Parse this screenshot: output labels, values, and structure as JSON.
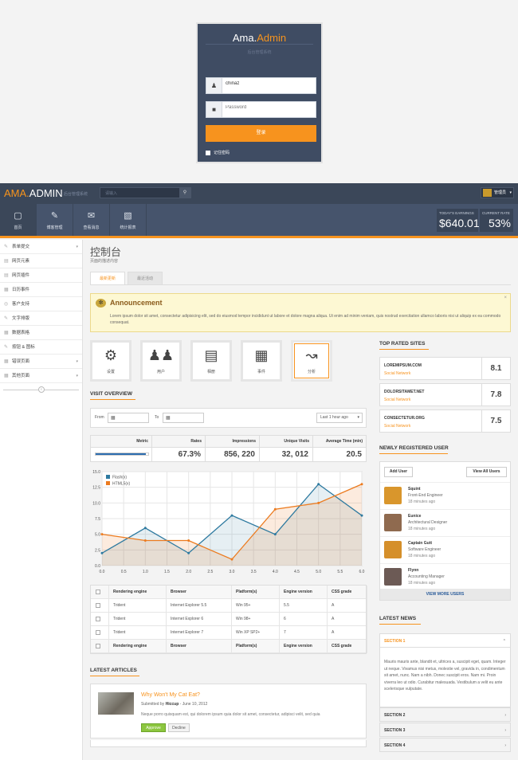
{
  "login": {
    "brand_a": "Ama.",
    "brand_b": "Admin",
    "subtitle": "后台管理系统",
    "username": "chinaz",
    "password_placeholder": "Password",
    "submit": "登录",
    "remember": "记住密码"
  },
  "topbar": {
    "logo_a": "AMA.",
    "logo_b": "ADMIN",
    "tagline": "后台管理系统",
    "search_placeholder": "请输入",
    "user": "管理员"
  },
  "nav": {
    "items": [
      {
        "label": "首页",
        "icon": "monitor-icon"
      },
      {
        "label": "博客管理",
        "icon": "pencil-icon"
      },
      {
        "label": "查看消息",
        "icon": "mail-icon"
      },
      {
        "label": "统计报表",
        "icon": "bars-icon"
      }
    ],
    "earnings_label": "TODAY'S EARNINGS",
    "earnings_value": "$640.01",
    "rate_label": "CURRENT RATE",
    "rate_value": "53%"
  },
  "sidebar": {
    "items": [
      {
        "label": "表单提交",
        "has_caret": true
      },
      {
        "label": "网页元素",
        "has_caret": false
      },
      {
        "label": "网页插件",
        "has_caret": false
      },
      {
        "label": "日历事件",
        "has_caret": false
      },
      {
        "label": "客户支持",
        "has_caret": false
      },
      {
        "label": "文字排版",
        "has_caret": false
      },
      {
        "label": "数据表格",
        "has_caret": false
      },
      {
        "label": "按钮 & 图标",
        "has_caret": false
      },
      {
        "label": "错误页面",
        "has_caret": true
      },
      {
        "label": "其他页面",
        "has_caret": true
      }
    ]
  },
  "page": {
    "title": "控制台",
    "subtitle": "页面的描述内容",
    "tabs": [
      "最新更新",
      "最近活动"
    ]
  },
  "announcement": {
    "title": "Announcement",
    "text": "Lorem ipsum dolor sit amet, consectetur adipisicing elit, sed do eiusmod tempor incididunt ut labore et dolore magna aliqua. Ut enim ad minim veniam, quis nostrud exercitation ullamco laboris nisi ut aliquip ex ea commodo consequat.",
    "close": "×"
  },
  "quick": [
    {
      "label": "设置",
      "icon": "gears-icon"
    },
    {
      "label": "用户",
      "icon": "users-icon"
    },
    {
      "label": "相册",
      "icon": "image-icon"
    },
    {
      "label": "事件",
      "icon": "calendar-icon"
    },
    {
      "label": "分析",
      "icon": "chart-icon"
    }
  ],
  "visit": {
    "heading": "VISIT OVERVIEW",
    "from": "From",
    "to": "To",
    "range": "Last 1 hour ago",
    "metrics": {
      "headers": [
        "Metric",
        "Rates",
        "Impressions",
        "Unique Visits",
        "Average Time (min)"
      ],
      "values": [
        "",
        "67.3%",
        "856, 220",
        "32, 012",
        "20.5"
      ],
      "bar_fill": 0.95
    }
  },
  "chart_data": {
    "type": "line",
    "x": [
      0,
      1,
      2,
      3,
      4,
      5,
      6
    ],
    "series": [
      {
        "name": "Flash(x)",
        "values": [
          2,
          6,
          2,
          8,
          5,
          13,
          8
        ],
        "color": "#2e7aa0"
      },
      {
        "name": "HTML5(x)",
        "values": [
          5,
          4,
          4,
          1,
          9,
          10,
          13
        ],
        "color": "#ec7b1f"
      }
    ],
    "xlim": [
      0,
      6
    ],
    "ylim": [
      0,
      15
    ],
    "xticks": [
      "0.0",
      "0.5",
      "1.0",
      "1.5",
      "2.0",
      "2.5",
      "3.0",
      "3.5",
      "4.0",
      "4.5",
      "5.0",
      "5.5",
      "6.0"
    ],
    "yticks": [
      "0.0",
      "2.5",
      "5.0",
      "7.5",
      "10.0",
      "12.5",
      "15.0"
    ],
    "grid": true,
    "legend": "top-left"
  },
  "engines": {
    "headers": [
      "Rendering engine",
      "Browser",
      "Platform(s)",
      "Engine version",
      "CSS grade"
    ],
    "rows": [
      [
        "Trident",
        "Internet Explorer 5.5",
        "Win 95+",
        "5.5",
        "A"
      ],
      [
        "Trident",
        "Internet Explorer 6",
        "Win 98+",
        "6",
        "A"
      ],
      [
        "Trident",
        "Internet Explorer 7",
        "Win XP SP2+",
        "7",
        "A"
      ]
    ]
  },
  "articles": {
    "heading": "LATEST ARTICLES",
    "title": "Why Won't My Cat Eat?",
    "meta_prefix": "Submitted by ",
    "author": "Hiccup",
    "date": " - June 10, 2012",
    "body": "Neque porro quisquam est, qui dolorem ipsum quia dolor sit amet, consectetur, adipisci velit, sed quia",
    "approve": "Approve",
    "decline": "Decline"
  },
  "top_sites": {
    "heading": "TOP RATED SITES",
    "items": [
      {
        "name": "LOREMIPSUM.COM",
        "category": "Social Network",
        "score": "8.1"
      },
      {
        "name": "DOLORSITAMET.NET",
        "category": "Social Network",
        "score": "7.8"
      },
      {
        "name": "CONSECTETUR.ORG",
        "category": "Social Network",
        "score": "7.5"
      }
    ]
  },
  "new_users": {
    "heading": "NEWLY REGISTERED USER",
    "add": "Add User",
    "view_all": "View All Users",
    "items": [
      {
        "name": "Squint",
        "role": "Front-End Engineer",
        "time": "18 minutes ago"
      },
      {
        "name": "Eunice",
        "role": "Architectural Designer",
        "time": "18 minutes ago"
      },
      {
        "name": "Captain Gutt",
        "role": "Software Engineer",
        "time": "18 minutes ago"
      },
      {
        "name": "Flynn",
        "role": "Accounting Manager",
        "time": "18 minutes ago"
      }
    ],
    "view_more": "VIEW MORE USERS"
  },
  "news": {
    "heading": "LATEST NEWS",
    "sections": [
      "SECTION 1",
      "SECTION 2",
      "SECTION 3",
      "SECTION 4"
    ],
    "body": "Mauris mauris ante, blandit et, ultrices a, suscipit eget, quam. Integer ut neque. Vivamus nisi metus, molestie vel, gravida in, condimentum sit amet, nunc. Nam a nibh. Donec suscipit eros. Nam mi. Proin viverra leo ut odio. Curabitur malesuada. Vestibulum a velit eu ante scelerisque vulputate."
  }
}
